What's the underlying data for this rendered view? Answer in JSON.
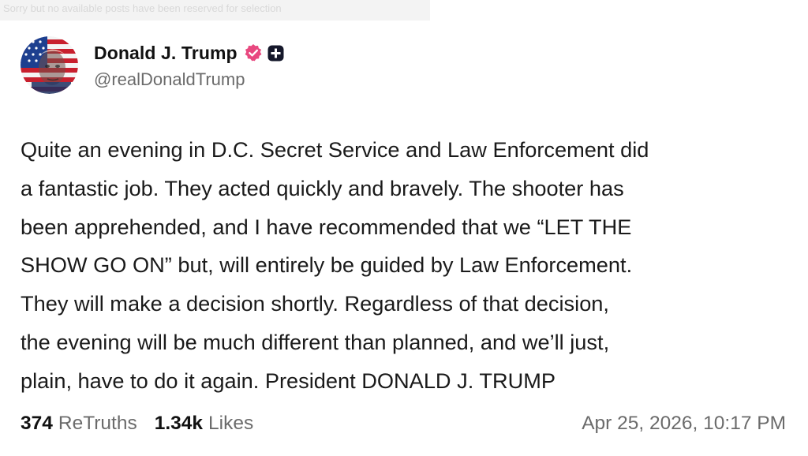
{
  "top_banner": {
    "text": "Sorry but no available posts have been reserved for selection"
  },
  "author": {
    "display_name": "Donald J. Trump",
    "handle": "@realDonaldTrump",
    "avatar_icon": "flag-portrait-avatar",
    "verified_icon": "verified-badge-icon",
    "verified_color": "#e8487f",
    "plus_icon": "plus-badge-icon"
  },
  "post": {
    "lines": [
      "Quite an evening in D.C. Secret Service and Law Enforcement did",
      "a fantastic job. They acted quickly and bravely. The shooter has",
      "been apprehended, and I have recommended that we “LET THE",
      "SHOW GO ON” but, will entirely be guided by Law Enforcement.",
      "They will make a decision shortly. Regardless of that decision,",
      "the evening will be much different than planned, and we’ll just,",
      "plain, have to do it again. President DONALD J. TRUMP"
    ]
  },
  "stats": {
    "retruths_count": "374",
    "retruths_label": "ReTruths",
    "likes_count": "1.34k",
    "likes_label": "Likes"
  },
  "timestamp": "Apr 25, 2026, 10:17 PM"
}
